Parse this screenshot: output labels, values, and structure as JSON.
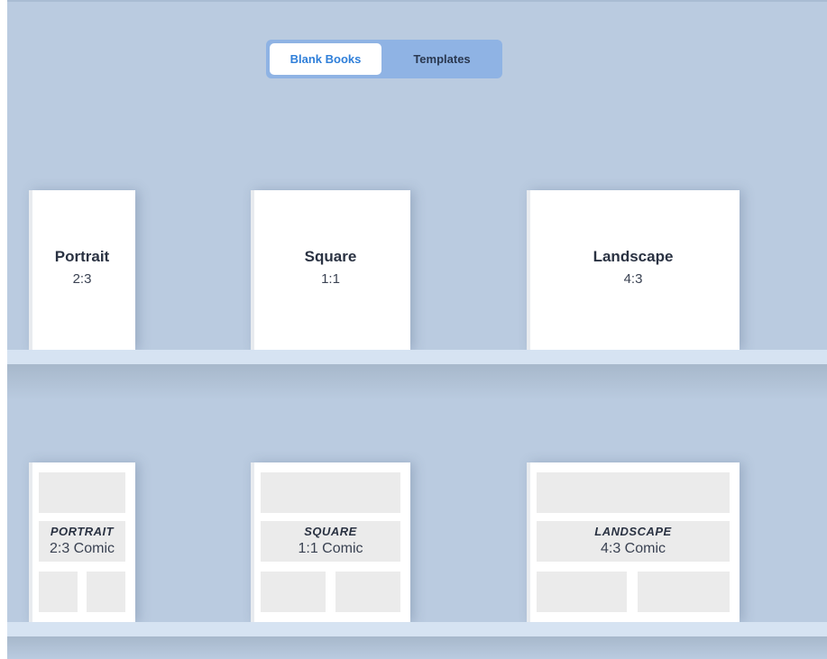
{
  "toggle": {
    "blank_label": "Blank Books",
    "templates_label": "Templates"
  },
  "blank_books": [
    {
      "title": "Portrait",
      "ratio": "2:3"
    },
    {
      "title": "Square",
      "ratio": "1:1"
    },
    {
      "title": "Landscape",
      "ratio": "4:3"
    }
  ],
  "comic_books": [
    {
      "title": "PORTRAIT",
      "ratio": "2:3 Comic"
    },
    {
      "title": "SQUARE",
      "ratio": "1:1 Comic"
    },
    {
      "title": "LANDSCAPE",
      "ratio": "4:3 Comic"
    }
  ],
  "colors": {
    "background": "#bacbe0",
    "accent": "#2f7fd9",
    "toggle_bg": "#8fb3e4",
    "shelf": "#d6e3f2",
    "panel": "#ebebeb"
  }
}
